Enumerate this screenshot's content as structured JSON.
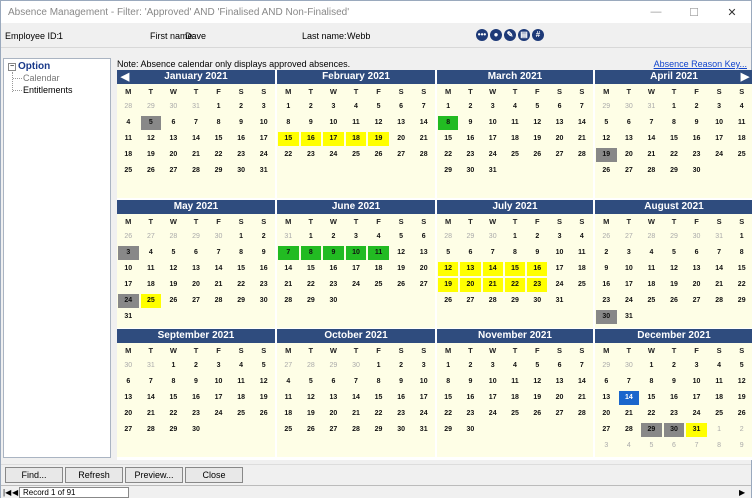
{
  "window": {
    "title": "Absence Management - Filter: 'Approved' AND 'Finalised AND Non-Finalised'",
    "minimize": "—",
    "maximize": "☐",
    "close": "✕"
  },
  "employee": {
    "id_label": "Employee ID:",
    "id_value": "1",
    "first_label": "First name:",
    "first_value": "Dave",
    "last_label": "Last name:",
    "last_value": "Webb"
  },
  "tree": {
    "root": "Option",
    "expander": "−",
    "items": [
      "Calendar",
      "Entitlements"
    ]
  },
  "note": "Note: Absence calendar only displays approved absences.",
  "legend_link": "Absence Reason Key...",
  "weekday_headers": [
    "M",
    "T",
    "W",
    "T",
    "F",
    "S",
    "S"
  ],
  "highlight_colors": {
    "y": "#ffff00",
    "g": "#22bb22",
    "gr": "#888888",
    "b": "#1a66cc"
  },
  "months": [
    {
      "name": "January 2021",
      "lead": 4,
      "days": 31,
      "prevDays": 31,
      "hl": {
        "5": "gr"
      }
    },
    {
      "name": "February 2021",
      "lead": 0,
      "days": 28,
      "prevDays": 31,
      "hl": {
        "15": "y",
        "16": "y",
        "17": "y",
        "18": "y",
        "19": "y"
      }
    },
    {
      "name": "March 2021",
      "lead": 0,
      "days": 31,
      "prevDays": 28,
      "hl": {
        "8": "g"
      }
    },
    {
      "name": "April 2021",
      "lead": 3,
      "days": 30,
      "prevDays": 31,
      "hl": {
        "19": "gr"
      }
    },
    {
      "name": "May 2021",
      "lead": 5,
      "days": 31,
      "prevDays": 30,
      "hl": {
        "3": "gr",
        "24": "gr",
        "25": "y"
      }
    },
    {
      "name": "June 2021",
      "lead": 1,
      "days": 30,
      "prevDays": 31,
      "hl": {
        "7": "g",
        "8": "g",
        "9": "g",
        "10": "g",
        "11": "g"
      }
    },
    {
      "name": "July 2021",
      "lead": 3,
      "days": 31,
      "prevDays": 30,
      "hl": {
        "12": "y",
        "13": "y",
        "14": "y",
        "15": "y",
        "16": "y",
        "19": "y",
        "20": "y",
        "21": "y",
        "22": "y",
        "23": "y"
      }
    },
    {
      "name": "August 2021",
      "lead": 6,
      "days": 31,
      "prevDays": 31,
      "hl": {
        "30": "gr"
      }
    },
    {
      "name": "September 2021",
      "lead": 2,
      "days": 30,
      "prevDays": 31,
      "hl": {}
    },
    {
      "name": "October 2021",
      "lead": 4,
      "days": 31,
      "prevDays": 30,
      "hl": {}
    },
    {
      "name": "November 2021",
      "lead": 0,
      "days": 30,
      "prevDays": 31,
      "hl": {}
    },
    {
      "name": "December 2021",
      "lead": 2,
      "days": 31,
      "prevDays": 30,
      "trail": 9,
      "hl": {
        "14": "b",
        "29": "gr",
        "30": "gr",
        "31": "y"
      }
    }
  ],
  "nav_arrows": {
    "prev": "◀",
    "next": "▶"
  },
  "buttons": {
    "find": "Find...",
    "refresh": "Refresh",
    "preview": "Preview...",
    "close": "Close"
  },
  "navigation": {
    "first": "|◀",
    "prev": "◀",
    "record": "Record 1 of 91",
    "next": "▶"
  }
}
